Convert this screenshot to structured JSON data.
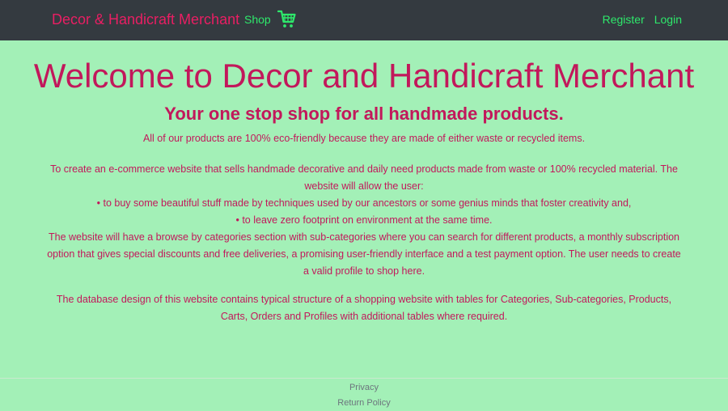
{
  "nav": {
    "brand": "Decor & Handicraft Merchant",
    "shop": "Shop",
    "cart_icon": "shopping-cart-icon",
    "register": "Register",
    "login": "Login"
  },
  "main": {
    "title": "Welcome to Decor and Handicraft Merchant",
    "subtitle": "Your one stop shop for all handmade products.",
    "eco_line": "All of our products are 100% eco-friendly because they are made of either waste or recycled items.",
    "desc_intro": "To create an e-commerce website that sells handmade decorative and daily need products made from waste or 100% recycled material. The website will allow the user:",
    "desc_bullet1": "• to buy some beautiful stuff made by techniques used by our ancestors or some genius minds that foster creativity and,",
    "desc_bullet2": "• to leave zero footprint on environment at the same time.",
    "desc_features": "The website will have a browse by categories section with sub-categories where you can search for different products, a monthly subscription option that gives special discounts and free deliveries, a promising user-friendly interface and a test payment option. The user needs to create a valid profile to shop here.",
    "db_paragraph": "The database design of this website contains typical structure of a shopping website with tables for Categories, Sub-categories, Products, Carts, Orders and Profiles with additional tables where required."
  },
  "footer": {
    "privacy": "Privacy",
    "return_policy": "Return Policy"
  },
  "colors": {
    "navbar_bg": "#343a40",
    "page_bg": "#a3f0b7",
    "brand": "#e91e63",
    "nav_link": "#2ee86b",
    "text": "#c2185b"
  }
}
